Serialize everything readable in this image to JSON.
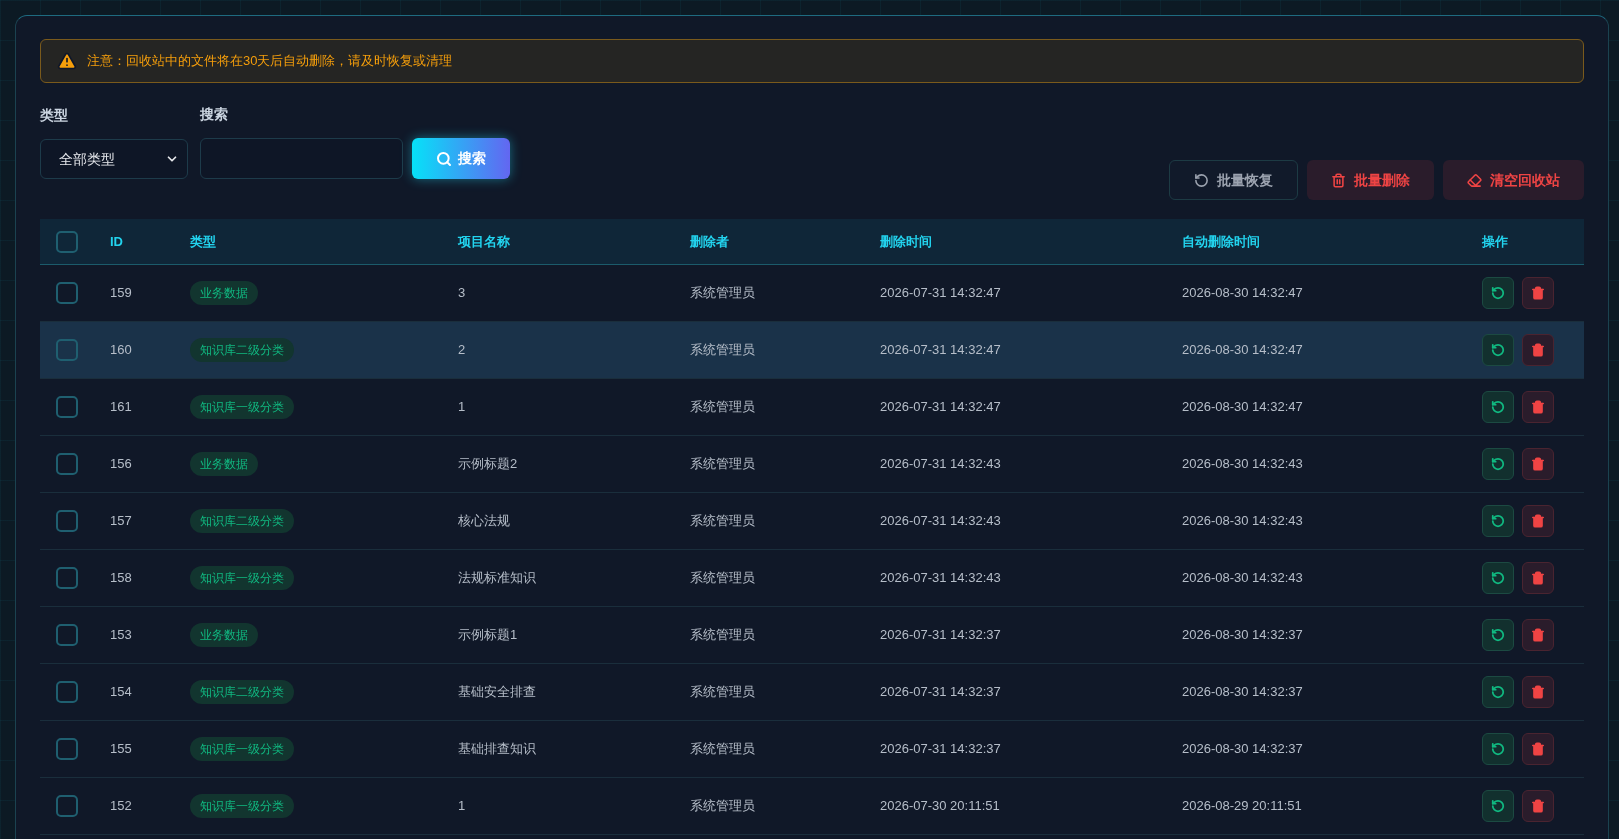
{
  "notice": "注意：回收站中的文件将在30天后自动删除，请及时恢复或清理",
  "filters": {
    "type_label": "类型",
    "type_value": "全部类型",
    "search_label": "搜索",
    "search_button": "搜索"
  },
  "actions": [
    {
      "kind": "restore",
      "label": "批量恢复"
    },
    {
      "kind": "delete",
      "label": "批量删除"
    },
    {
      "kind": "clear",
      "label": "清空回收站"
    }
  ],
  "table": {
    "select_all": {
      "checked": false
    },
    "columns": [
      "ID",
      "类型",
      "项目名称",
      "删除者",
      "删除时间",
      "自动删除时间",
      "操作"
    ],
    "rows": [
      {
        "checked": false,
        "highlighted": false,
        "id": "159",
        "type": "业务数据",
        "name": "3",
        "deleter": "系统管理员",
        "deleted_at": "2026-07-31 14:32:47",
        "auto_delete_at": "2026-08-30 14:32:47"
      },
      {
        "checked": false,
        "highlighted": true,
        "id": "160",
        "type": "知识库二级分类",
        "name": "2",
        "deleter": "系统管理员",
        "deleted_at": "2026-07-31 14:32:47",
        "auto_delete_at": "2026-08-30 14:32:47"
      },
      {
        "checked": false,
        "highlighted": false,
        "id": "161",
        "type": "知识库一级分类",
        "name": "1",
        "deleter": "系统管理员",
        "deleted_at": "2026-07-31 14:32:47",
        "auto_delete_at": "2026-08-30 14:32:47"
      },
      {
        "checked": false,
        "highlighted": false,
        "id": "156",
        "type": "业务数据",
        "name": "示例标题2",
        "deleter": "系统管理员",
        "deleted_at": "2026-07-31 14:32:43",
        "auto_delete_at": "2026-08-30 14:32:43"
      },
      {
        "checked": false,
        "highlighted": false,
        "id": "157",
        "type": "知识库二级分类",
        "name": "核心法规",
        "deleter": "系统管理员",
        "deleted_at": "2026-07-31 14:32:43",
        "auto_delete_at": "2026-08-30 14:32:43"
      },
      {
        "checked": false,
        "highlighted": false,
        "id": "158",
        "type": "知识库一级分类",
        "name": "法规标准知识",
        "deleter": "系统管理员",
        "deleted_at": "2026-07-31 14:32:43",
        "auto_delete_at": "2026-08-30 14:32:43"
      },
      {
        "checked": false,
        "highlighted": false,
        "id": "153",
        "type": "业务数据",
        "name": "示例标题1",
        "deleter": "系统管理员",
        "deleted_at": "2026-07-31 14:32:37",
        "auto_delete_at": "2026-08-30 14:32:37"
      },
      {
        "checked": false,
        "highlighted": false,
        "id": "154",
        "type": "知识库二级分类",
        "name": "基础安全排查",
        "deleter": "系统管理员",
        "deleted_at": "2026-07-31 14:32:37",
        "auto_delete_at": "2026-08-30 14:32:37"
      },
      {
        "checked": false,
        "highlighted": false,
        "id": "155",
        "type": "知识库一级分类",
        "name": "基础排查知识",
        "deleter": "系统管理员",
        "deleted_at": "2026-07-31 14:32:37",
        "auto_delete_at": "2026-08-30 14:32:37"
      },
      {
        "checked": false,
        "highlighted": false,
        "id": "152",
        "type": "知识库一级分类",
        "name": "1",
        "deleter": "系统管理员",
        "deleted_at": "2026-07-30 20:11:51",
        "auto_delete_at": "2026-08-29 20:11:51"
      }
    ]
  }
}
